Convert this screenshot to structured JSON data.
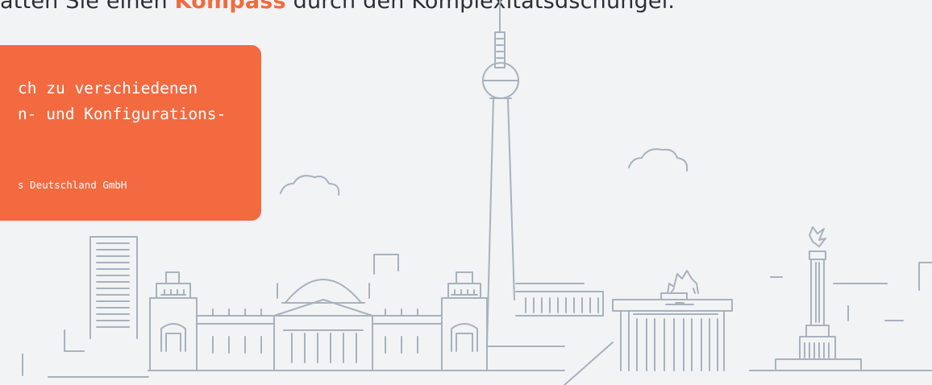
{
  "headline": {
    "before": "atten Sie einen ",
    "keyword": "Kompass",
    "after": " durch den Komplexitätsdschungel."
  },
  "quote_card": {
    "text_line1": "ch zu verschiedenen",
    "text_line2": "n- und Konfigurations-",
    "company": "s Deutschland GmbH",
    "color": "#f36a40"
  },
  "illustration": {
    "name": "berlin-skyline",
    "line_color": "#a7b2be"
  }
}
